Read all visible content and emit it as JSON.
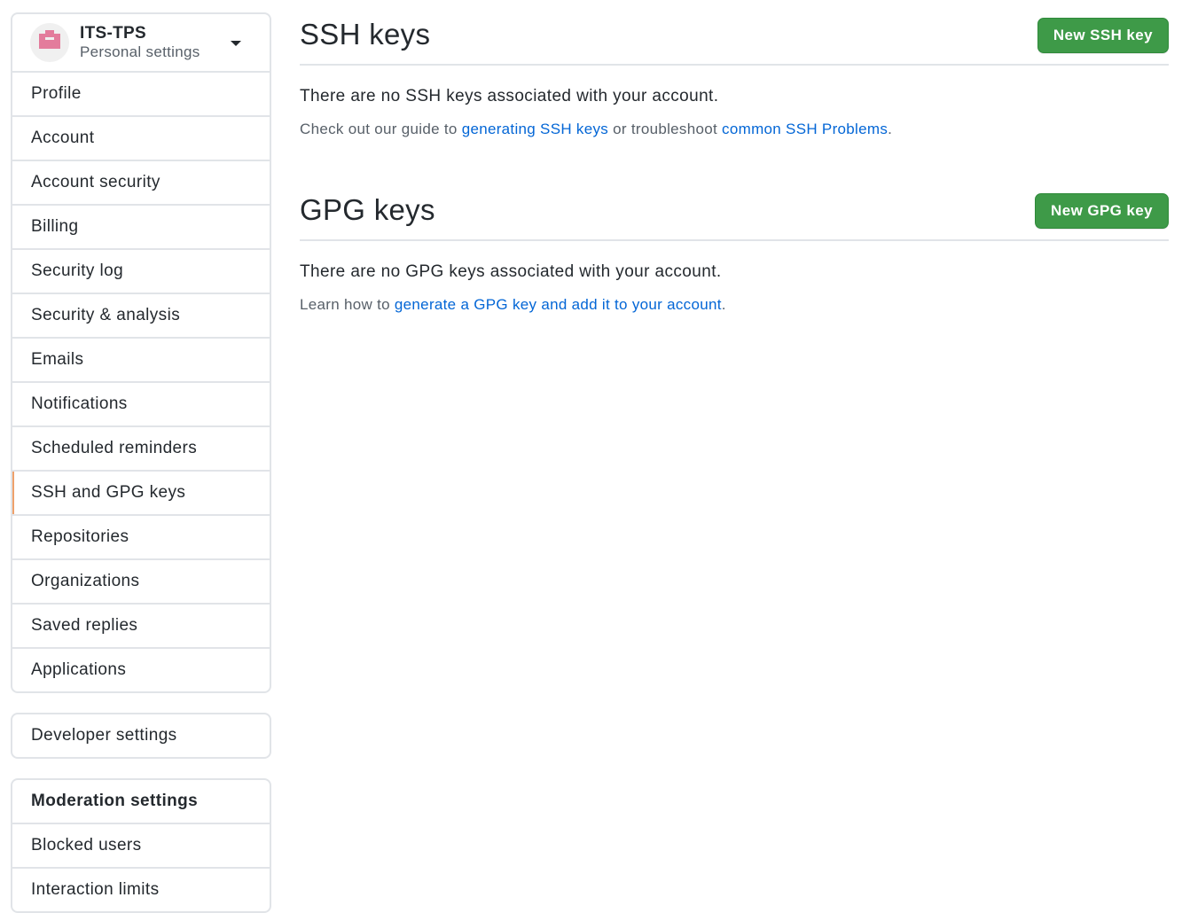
{
  "account": {
    "name": "ITS-TPS",
    "subtitle": "Personal settings"
  },
  "sidebar": {
    "items": [
      {
        "label": "Profile"
      },
      {
        "label": "Account"
      },
      {
        "label": "Account security"
      },
      {
        "label": "Billing"
      },
      {
        "label": "Security log"
      },
      {
        "label": "Security & analysis"
      },
      {
        "label": "Emails"
      },
      {
        "label": "Notifications"
      },
      {
        "label": "Scheduled reminders"
      },
      {
        "label": "SSH and GPG keys",
        "selected": true
      },
      {
        "label": "Repositories"
      },
      {
        "label": "Organizations"
      },
      {
        "label": "Saved replies"
      },
      {
        "label": "Applications"
      }
    ],
    "developer": "Developer settings",
    "moderation": {
      "heading": "Moderation settings",
      "items": [
        {
          "label": "Blocked users"
        },
        {
          "label": "Interaction limits"
        }
      ]
    },
    "selected_accent": "#e36209"
  },
  "ssh": {
    "title": "SSH keys",
    "button": "New SSH key",
    "blank": "There are no SSH keys associated with your account.",
    "note_prefix": "Check out our guide to ",
    "link1": "generating SSH keys",
    "note_mid": " or troubleshoot ",
    "link2": "common SSH Problems",
    "note_suffix": "."
  },
  "gpg": {
    "title": "GPG keys",
    "button": "New GPG key",
    "blank": "There are no GPG keys associated with your account.",
    "note_prefix": "Learn how to ",
    "link1": "generate a GPG key and add it to your account",
    "note_suffix": "."
  },
  "colors": {
    "primary_button": "#3e9a48",
    "link": "#0366d6"
  }
}
